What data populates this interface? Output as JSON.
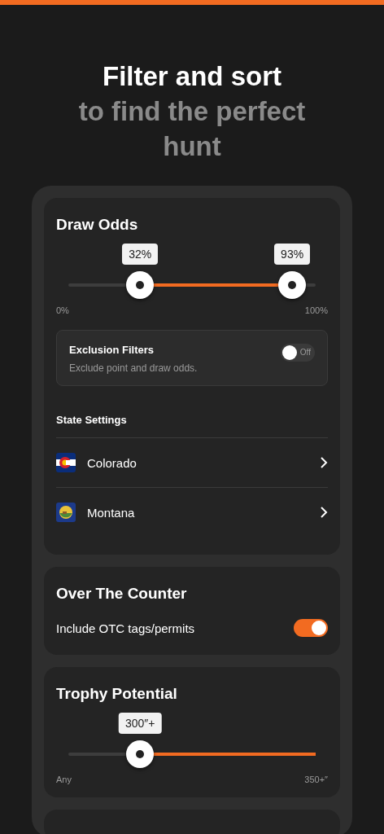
{
  "header": {
    "title": "Filter and sort",
    "subtitle": "to find the perfect hunt"
  },
  "draw_odds": {
    "title": "Draw Odds",
    "thumbs": [
      {
        "label": "32%"
      },
      {
        "label": "93%"
      }
    ],
    "min_label": "0%",
    "max_label": "100%",
    "exclusion": {
      "title": "Exclusion Filters",
      "description": "Exclude point and draw odds.",
      "on": false,
      "toggle_label": "Off"
    },
    "state_settings": {
      "title": "State Settings",
      "states": [
        {
          "name": "Colorado",
          "kind": "colorado"
        },
        {
          "name": "Montana",
          "kind": "montana"
        }
      ]
    }
  },
  "over_the_counter": {
    "title": "Over The Counter",
    "label": "Include OTC tags/permits",
    "on": true
  },
  "trophy_potential": {
    "title": "Trophy Potential",
    "thumbs": [
      {
        "label": "300″+"
      }
    ],
    "min_label": "Any",
    "max_label": "350+″"
  }
}
